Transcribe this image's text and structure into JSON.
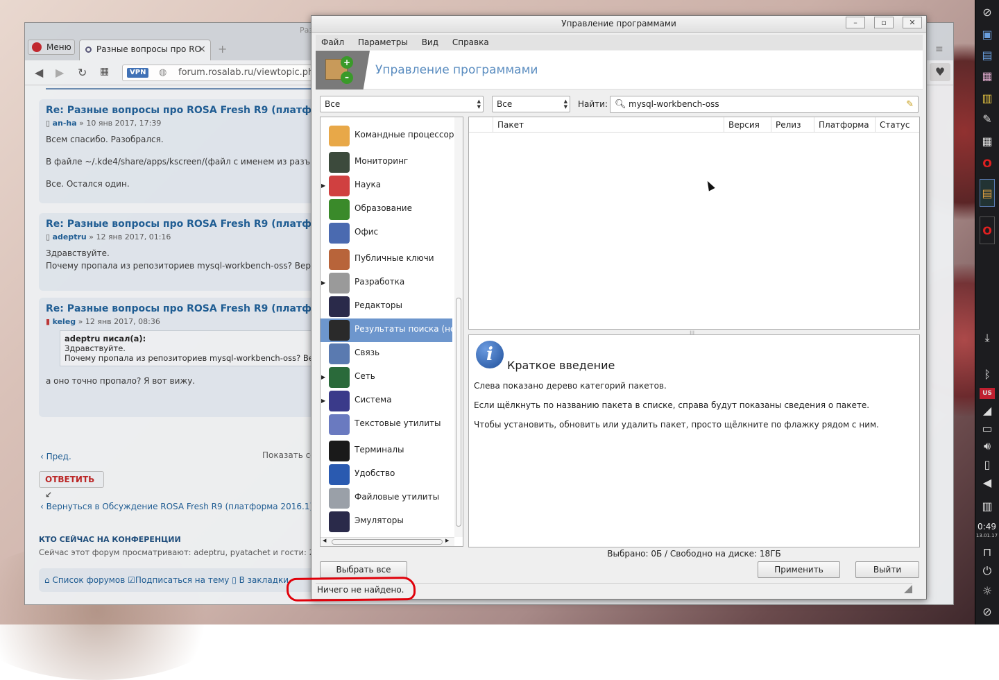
{
  "browser": {
    "menu_label": "Меню",
    "tab_title": "Разные вопросы про RO",
    "tab_close": "×",
    "new_tab": "+",
    "vpn": "VPN",
    "url": "forum.rosalab.ru/viewtopic.php",
    "window_hint": "Раз"
  },
  "forum": {
    "posts": [
      {
        "title": "Re: Разные вопросы про ROSA Fresh R9 (платформа",
        "author": "an-ha",
        "date": "» 10 янв 2017, 17:39",
        "lines": [
          "Всем спасибо. Разобрался.",
          "В файле ~/.kde4/share/apps/kscreen/(файл с именем из разъ",
          "Все. Остался один."
        ]
      },
      {
        "title": "Re: Разные вопросы про ROSA Fresh R9 (платформа",
        "author": "adeptru",
        "date": "» 12 янв 2017, 01:16",
        "lines": [
          "Здравствуйте.",
          "Почему пропала из репозиториев mysql-workbench-oss? Вернут"
        ]
      },
      {
        "title": "Re: Разные вопросы про ROSA Fresh R9 (платформа",
        "author": "keleg",
        "date": "» 12 янв 2017, 08:36",
        "quote_author": "adeptru писал(а):",
        "quote_lines": [
          "Здравствуйте.",
          "Почему пропала из репозиториев mysql-workbench-oss? Верну"
        ],
        "lines": [
          "а оно точно пропало? Я вот вижу."
        ]
      }
    ],
    "prev": "Пред.",
    "show": "Показать со",
    "reply": "ОТВЕТИТЬ",
    "back": "Вернуться в Обсуждение ROSA Fresh R9 (платформа 2016.1)",
    "who_title": "КТО СЕЙЧАС НА КОНФЕРЕНЦИИ",
    "who_text": "Сейчас этот форум просматривают: adeptru, pyatachet и гости: 2",
    "bottom": [
      "Список форумов",
      "Подписаться на тему",
      "В закладки"
    ]
  },
  "app": {
    "title": "Управление программами",
    "menu": [
      "Файл",
      "Параметры",
      "Вид",
      "Справка"
    ],
    "header_title": "Управление программами",
    "filter1": "Все",
    "filter2": "Все",
    "find_label": "Найти:",
    "search_value": "mysql-workbench-oss",
    "categories": [
      {
        "label": "Командные процессоры",
        "expander": false,
        "color": "#e8a848"
      },
      {
        "label": "Мониторинг",
        "expander": false,
        "color": "#3c4a3c"
      },
      {
        "label": "Наука",
        "expander": true,
        "color": "#d04040"
      },
      {
        "label": "Образование",
        "expander": false,
        "color": "#3a8a2a"
      },
      {
        "label": "Офис",
        "expander": false,
        "color": "#4a6ab0"
      },
      {
        "label": "Публичные ключи",
        "expander": false,
        "color": "#b8643a"
      },
      {
        "label": "Разработка",
        "expander": true,
        "color": "#9a9a9a"
      },
      {
        "label": "Редакторы",
        "expander": false,
        "color": "#2a2a4a"
      },
      {
        "label": "Результаты поиска (нет)",
        "expander": false,
        "color": "#2a2a2a",
        "selected": true
      },
      {
        "label": "Связь",
        "expander": false,
        "color": "#5a7ab0"
      },
      {
        "label": "Сеть",
        "expander": true,
        "color": "#2a6a3a"
      },
      {
        "label": "Система",
        "expander": true,
        "color": "#3a3a8a"
      },
      {
        "label": "Текстовые утилиты",
        "expander": false,
        "color": "#6a7ac0"
      },
      {
        "label": "Терминалы",
        "expander": false,
        "color": "#1a1a1a"
      },
      {
        "label": "Удобство",
        "expander": false,
        "color": "#2a5ab0"
      },
      {
        "label": "Файловые утилиты",
        "expander": false,
        "color": "#9aa0a8"
      },
      {
        "label": "Эмуляторы",
        "expander": false,
        "color": "#2a2a4a"
      }
    ],
    "columns": [
      "Пакет",
      "Версия",
      "Релиз",
      "Платформа",
      "Статус"
    ],
    "info_title": "Краткое введение",
    "info_lines": [
      "Слева показано дерево категорий пакетов.",
      "Если щёлкнуть по названию пакета в списке, справа будут показаны сведения о пакете.",
      "Чтобы установить, обновить или удалить пакет, просто щёлкните по флажку рядом с ним."
    ],
    "selected_text": "Выбрано: 0Б / Свободно на диске: 18ГБ",
    "select_all": "Выбрать все",
    "apply": "Применить",
    "quit": "Выйти",
    "status": "Ничего не найдено."
  },
  "panel": {
    "time": "0:49",
    "date": "13.01.17",
    "lang": "US"
  }
}
